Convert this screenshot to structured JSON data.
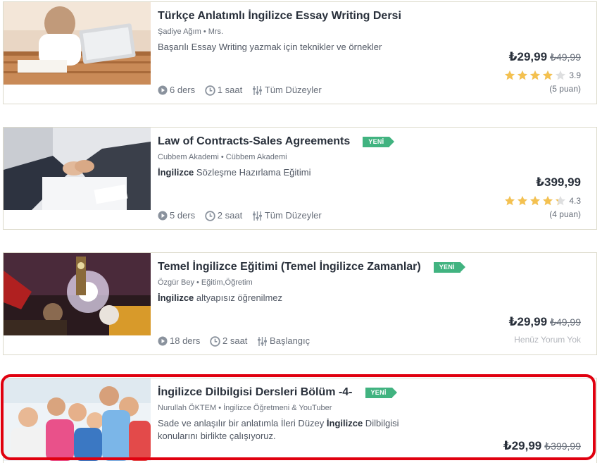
{
  "courses": [
    {
      "title": "Türkçe Anlatımlı İngilizce Essay Writing Dersi",
      "badge": "",
      "author": "Şadiye Ağım • Mrs.",
      "desc_bold": "",
      "desc": "Başarılı Essay Writing yazmak için teknikler ve örnekler",
      "lectures": "6 ders",
      "duration": "1 saat",
      "level": "Tüm Düzeyler",
      "price": "₺29,99",
      "old_price": "₺49,99",
      "rating": "3.9",
      "rating_value": 3.9,
      "reviews": "(5 puan)"
    },
    {
      "title": "Law of Contracts-Sales Agreements",
      "badge": "YENİ",
      "author": "Cubbem Akademi • Cübbem Akademi",
      "desc_bold": "İngilizce",
      "desc": " Sözleşme Hazırlama Eğitimi",
      "lectures": "5 ders",
      "duration": "2 saat",
      "level": "Tüm Düzeyler",
      "price": "₺399,99",
      "old_price": "",
      "rating": "4.3",
      "rating_value": 4.3,
      "reviews": "(4 puan)"
    },
    {
      "title": "Temel İngilizce Eğitimi (Temel İngilizce Zamanlar)",
      "badge": "YENİ",
      "author": "Özgür Bey • Eğitim,Öğretim",
      "desc_bold": "İngilizce",
      "desc": " altyapısız öğrenilmez",
      "lectures": "18 ders",
      "duration": "2 saat",
      "level": "Başlangıç",
      "price": "₺29,99",
      "old_price": "₺49,99",
      "no_reviews": "Henüz Yorum Yok"
    },
    {
      "title": "İngilizce Dilbilgisi Dersleri Bölüm -4-",
      "badge": "YENİ",
      "author": "Nurullah ÖKTEM • İngilizce Öğretmeni & YouTuber",
      "desc_pre": "Sade ve anlaşılır bir anlatımla İleri Düzey ",
      "desc_bold": "İngilizce",
      "desc_post": " Dilbilgisi konularını birlikte çalışıyoruz.",
      "price": "₺29,99",
      "old_price": "₺399,99"
    }
  ],
  "colors": {
    "badge": "#41b380",
    "star": "#f4c150",
    "highlight": "#e0000f"
  },
  "icons": [
    "play-circle-icon",
    "clock-icon",
    "level-sliders-icon",
    "star-icon"
  ]
}
